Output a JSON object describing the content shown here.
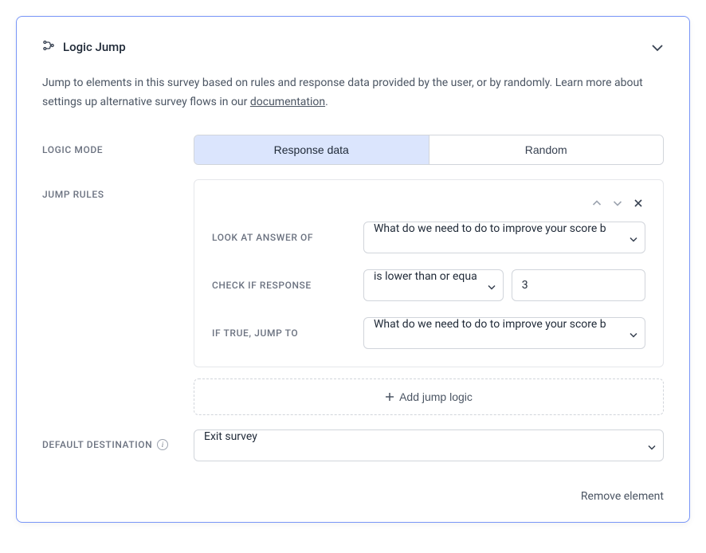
{
  "header": {
    "title": "Logic Jump"
  },
  "description": {
    "text_before": "Jump to elements in this survey based on rules and response data provided by the user, or by randomly. Learn more about settings up alternative survey flows in our ",
    "link_text": "documentation",
    "text_after": "."
  },
  "logic_mode": {
    "label": "LOGIC MODE",
    "options": {
      "response_data": "Response data",
      "random": "Random"
    }
  },
  "jump_rules": {
    "label": "JUMP RULES",
    "rule": {
      "look_at_label": "LOOK AT ANSWER OF",
      "look_at_value": "What do we need to do to improve your score b",
      "check_if_label": "CHECK IF RESPONSE",
      "check_if_operator": "is lower than or equa",
      "check_if_value": "3",
      "if_true_label": "IF TRUE, JUMP TO",
      "if_true_value": "What do we need to do to improve your score b"
    },
    "add_button": "Add jump logic"
  },
  "default_destination": {
    "label": "DEFAULT DESTINATION",
    "value": "Exit survey"
  },
  "footer": {
    "remove": "Remove element"
  }
}
